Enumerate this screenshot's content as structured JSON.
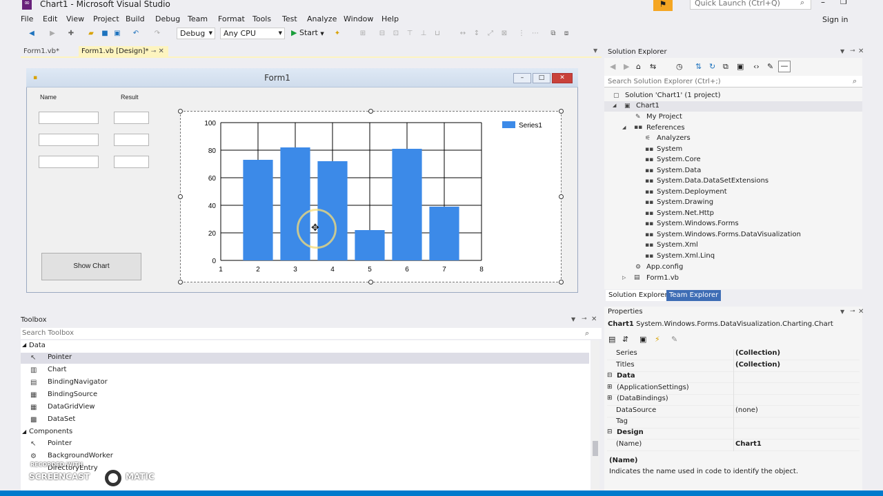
{
  "window": {
    "title": "Chart1 - Microsoft Visual Studio",
    "quick_launch_placeholder": "Quick Launch (Ctrl+Q)",
    "sign_in": "Sign in"
  },
  "menu": [
    "File",
    "Edit",
    "View",
    "Project",
    "Build",
    "Debug",
    "Team",
    "Format",
    "Tools",
    "Test",
    "Analyze",
    "Window",
    "Help"
  ],
  "toolbar": {
    "configuration": "Debug",
    "platform": "Any CPU",
    "start_label": "Start"
  },
  "tabs": [
    {
      "label": "Form1.vb*"
    },
    {
      "label": "Form1.vb [Design]*"
    }
  ],
  "form": {
    "caption": "Form1",
    "name_label": "Name",
    "result_label": "Result",
    "show_chart_button": "Show Chart"
  },
  "chart_data": {
    "type": "bar",
    "x": [
      2,
      3,
      4,
      5,
      6,
      7
    ],
    "values": [
      73,
      82,
      72,
      22,
      81,
      39
    ],
    "series": [
      {
        "name": "Series1",
        "values": [
          73,
          82,
          72,
          22,
          81,
          39
        ]
      }
    ],
    "xlim": [
      1,
      8
    ],
    "ylim": [
      0,
      100
    ],
    "xticks": [
      "1",
      "2",
      "3",
      "4",
      "5",
      "6",
      "7",
      "8"
    ],
    "yticks": [
      "0",
      "20",
      "40",
      "60",
      "80",
      "100"
    ],
    "grid": true,
    "legend": "top-right",
    "color": "#3c8ae8"
  },
  "toolbox": {
    "title": "Toolbox",
    "search_placeholder": "Search Toolbox",
    "groups": [
      {
        "name": "Data",
        "items": [
          "Pointer",
          "Chart",
          "BindingNavigator",
          "BindingSource",
          "DataGridView",
          "DataSet"
        ]
      },
      {
        "name": "Components",
        "items": [
          "Pointer",
          "BackgroundWorker",
          "DirectoryEntry"
        ]
      }
    ]
  },
  "solution_explorer": {
    "title": "Solution Explorer",
    "search_placeholder": "Search Solution Explorer (Ctrl+;)",
    "solution": "Solution 'Chart1' (1 project)",
    "project": "Chart1",
    "my_project": "My Project",
    "references_label": "References",
    "references": [
      "Analyzers",
      "System",
      "System.Core",
      "System.Data",
      "System.Data.DataSetExtensions",
      "System.Deployment",
      "System.Drawing",
      "System.Net.Http",
      "System.Windows.Forms",
      "System.Windows.Forms.DataVisualization",
      "System.Xml",
      "System.Xml.Linq"
    ],
    "app_config": "App.config",
    "form_file": "Form1.vb",
    "tabs": [
      "Solution Explorer",
      "Team Explorer"
    ]
  },
  "properties": {
    "title": "Properties",
    "object": "Chart1",
    "object_type": "System.Windows.Forms.DataVisualization.Charting.Chart",
    "rows": [
      {
        "name": "Series",
        "value": "(Collection)"
      },
      {
        "name": "Titles",
        "value": "(Collection)"
      }
    ],
    "data_category": "Data",
    "data_rows": [
      {
        "name": "(ApplicationSettings)",
        "value": ""
      },
      {
        "name": "(DataBindings)",
        "value": ""
      },
      {
        "name": "DataSource",
        "value": "(none)"
      },
      {
        "name": "Tag",
        "value": ""
      }
    ],
    "design_category": "Design",
    "design_rows": [
      {
        "name": "(Name)",
        "value": "Chart1"
      }
    ],
    "desc_title": "(Name)",
    "desc_text": "Indicates the name used in code to identify the object."
  },
  "watermark": {
    "line1": "RECORDED WITH",
    "line2": "SCREENCAST",
    "line3": "MATIC"
  }
}
